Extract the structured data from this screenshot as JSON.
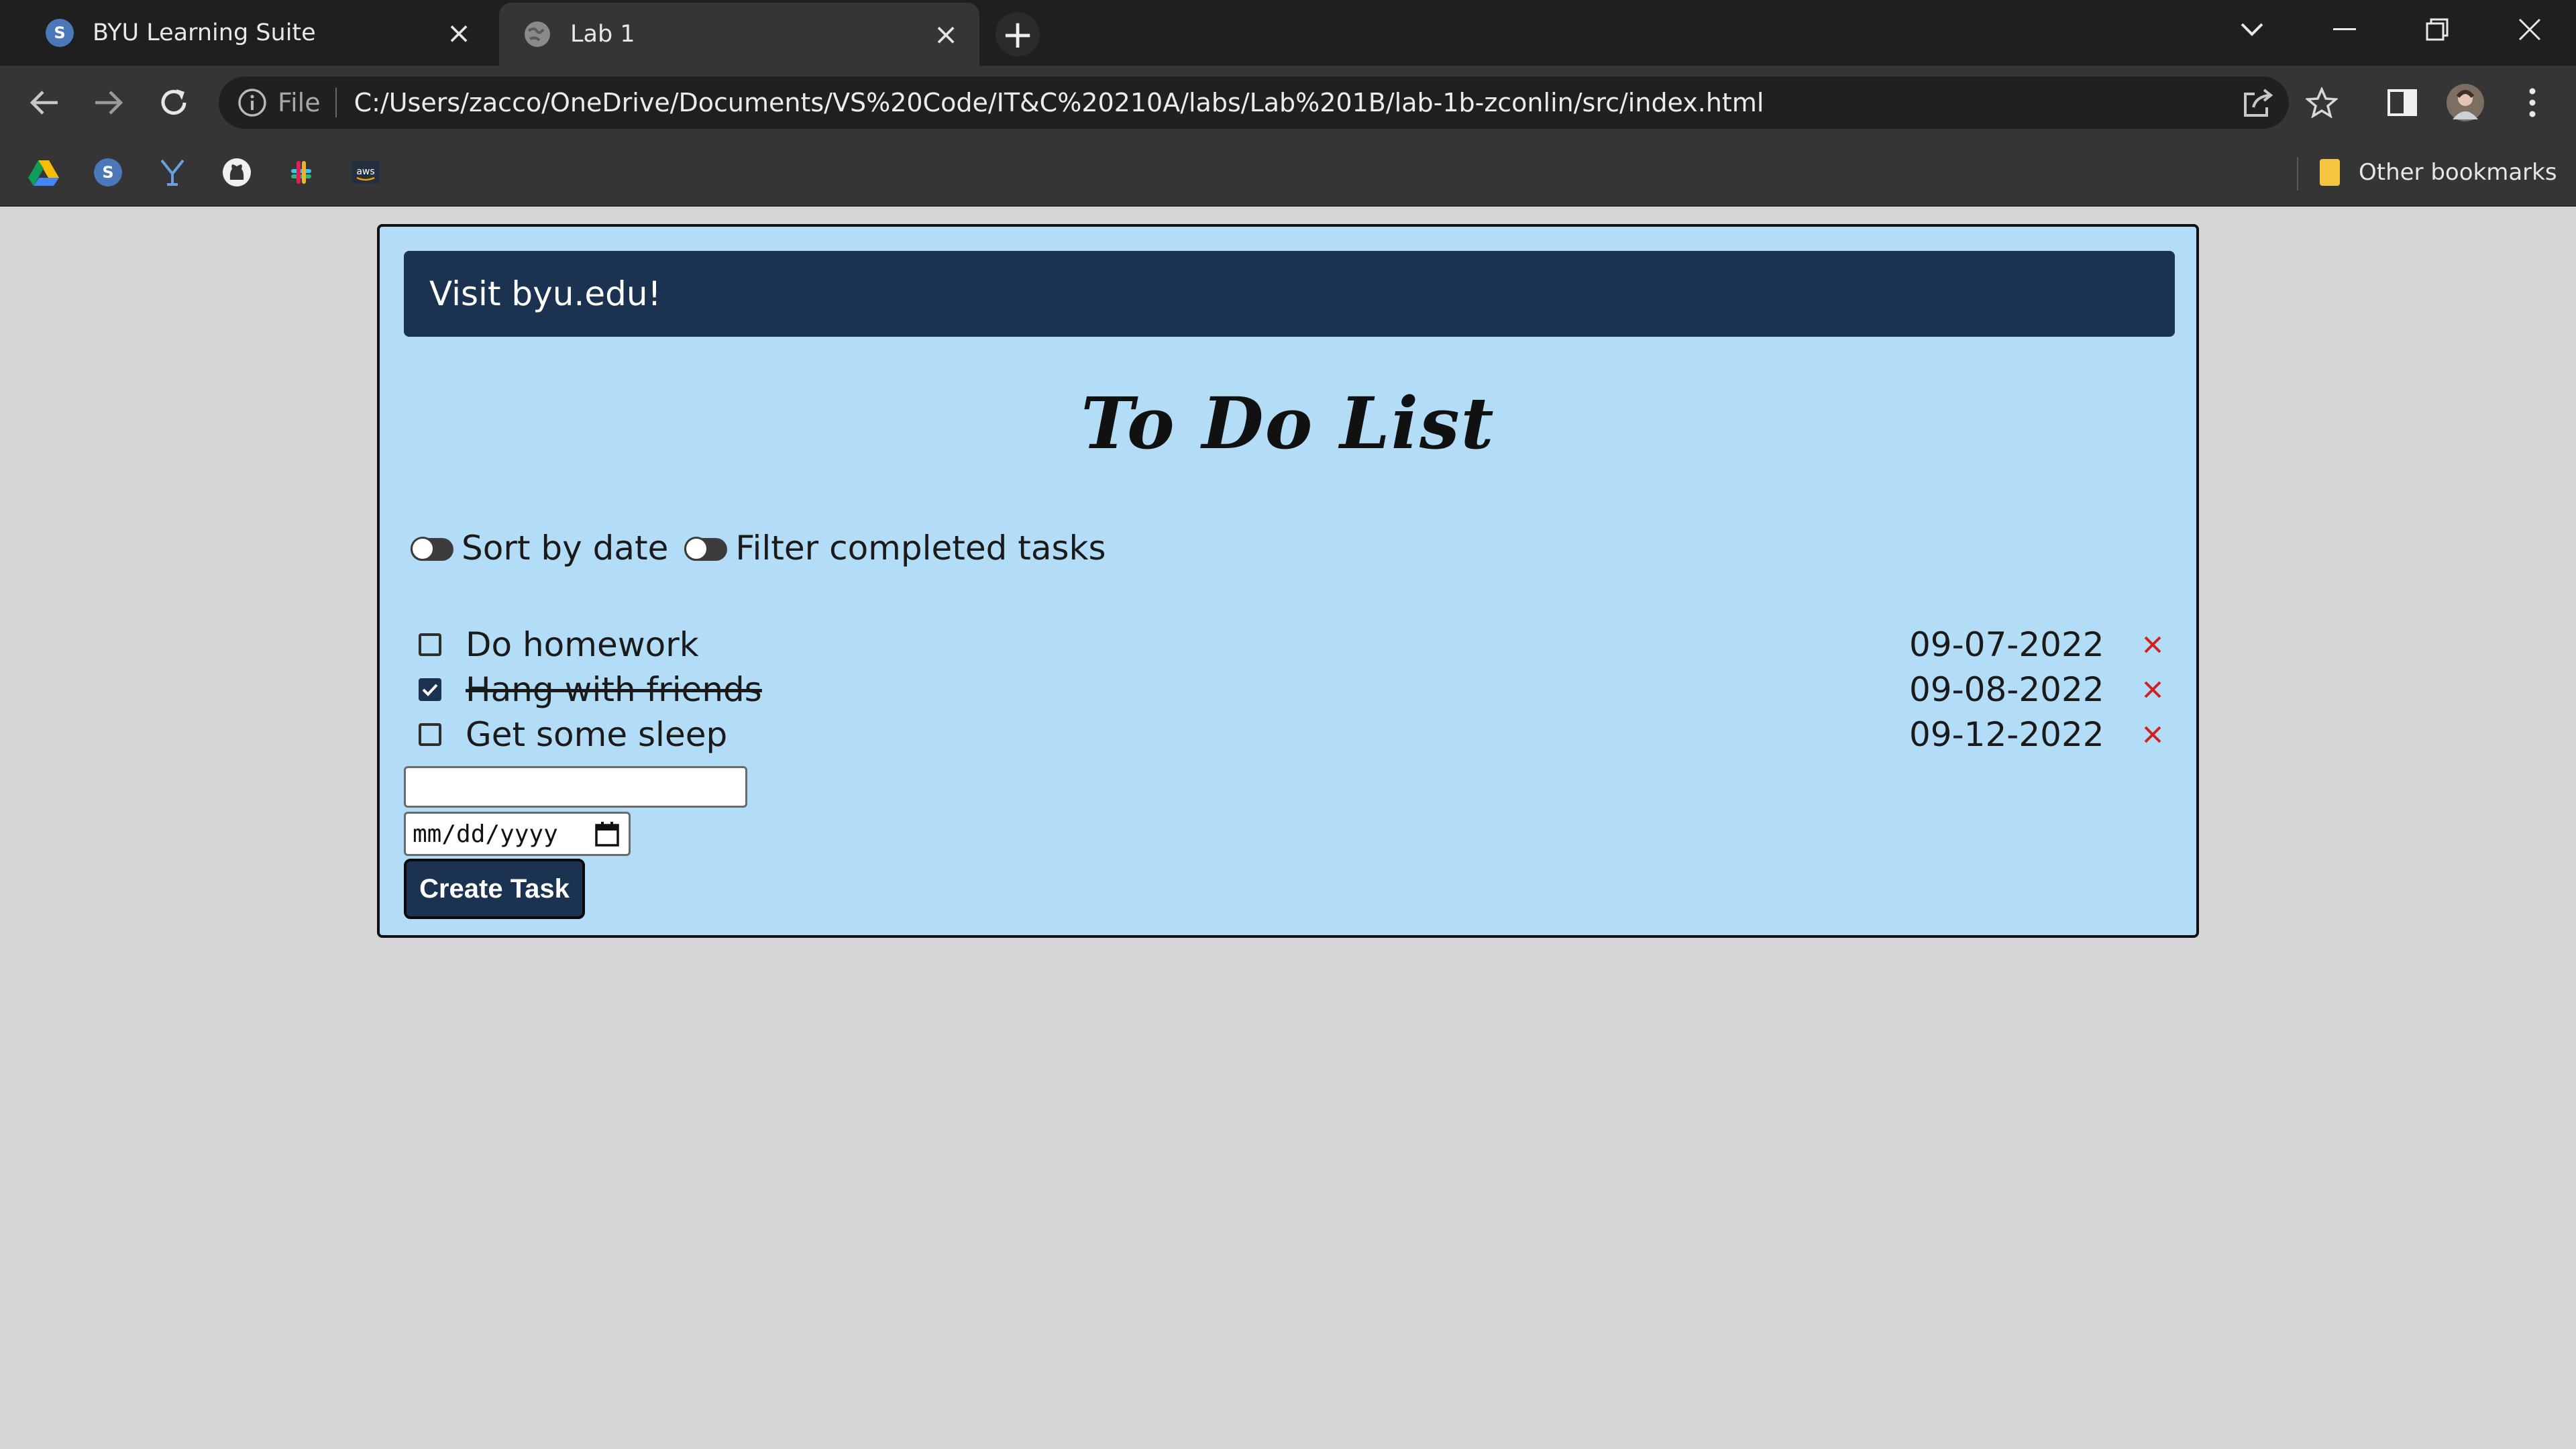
{
  "browser": {
    "tabs": [
      {
        "title": "BYU Learning Suite",
        "active": false,
        "icon": "learning-suite-icon"
      },
      {
        "title": "Lab 1",
        "active": true,
        "icon": "globe-icon"
      }
    ],
    "address": {
      "scheme_label": "File",
      "url": "C:/Users/zacco/OneDrive/Documents/VS%20Code/IT&C%20210A/labs/Lab%201B/lab-1b-zconlin/src/index.html"
    },
    "bookmarks": [
      "google-drive-icon",
      "learning-suite-icon",
      "byu-y-icon",
      "github-icon",
      "slack-icon",
      "aws-icon"
    ],
    "other_bookmarks_label": "Other bookmarks",
    "aws_text": "aws"
  },
  "page": {
    "banner_text": "Visit byu.edu!",
    "title": "To Do List",
    "sort_label": "Sort by date",
    "filter_label": "Filter completed tasks",
    "tasks": [
      {
        "text": "Do homework",
        "date": "09-07-2022",
        "done": false
      },
      {
        "text": "Hang with friends",
        "date": "09-08-2022",
        "done": true
      },
      {
        "text": "Get some sleep",
        "date": "09-12-2022",
        "done": false
      }
    ],
    "new_task_value": "",
    "date_placeholder": "mm/dd/yyyy",
    "create_button": "Create Task"
  },
  "colors": {
    "page_bg": "#d6d6d6",
    "card_bg": "#b3ddf6",
    "navy": "#1b3350",
    "delete_red": "#d21f1f"
  }
}
